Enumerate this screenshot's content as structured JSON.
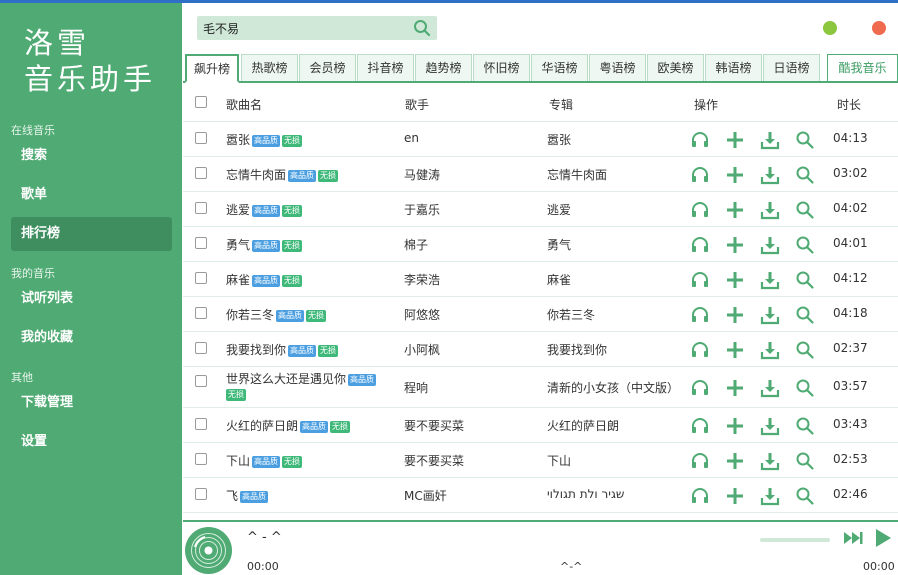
{
  "app": {
    "logo_line1": "洛雪",
    "logo_line2": "音乐助手"
  },
  "sidebar": {
    "sections": [
      {
        "title": "在线音乐",
        "items": [
          "搜索",
          "歌单",
          "排行榜"
        ]
      },
      {
        "title": "我的音乐",
        "items": [
          "试听列表",
          "我的收藏"
        ]
      },
      {
        "title": "其他",
        "items": [
          "下载管理",
          "设置"
        ]
      }
    ],
    "active": "排行榜"
  },
  "search": {
    "value": "毛不易"
  },
  "window_controls": {
    "min_color": "#8cc63f",
    "close_color": "#f06a4f"
  },
  "tabs": {
    "items": [
      "飙升榜",
      "热歌榜",
      "会员榜",
      "抖音榜",
      "趋势榜",
      "怀旧榜",
      "华语榜",
      "粤语榜",
      "欧美榜",
      "韩语榜",
      "日语榜"
    ],
    "active": "飙升榜",
    "source_label": "酷我音乐"
  },
  "table": {
    "headers": {
      "name": "歌曲名",
      "singer": "歌手",
      "album": "专辑",
      "actions": "操作",
      "duration": "时长"
    },
    "badges": {
      "hq": "高品质",
      "lossless": "无损"
    },
    "rows": [
      {
        "name": "嚣张",
        "singer": "en",
        "album": "嚣张",
        "duration": "04:13",
        "hq": true,
        "lossless": true
      },
      {
        "name": "忘情牛肉面",
        "singer": "马健涛",
        "album": "忘情牛肉面",
        "duration": "03:02",
        "hq": true,
        "lossless": true
      },
      {
        "name": "逃爱",
        "singer": "于嘉乐",
        "album": "逃爱",
        "duration": "04:02",
        "hq": true,
        "lossless": true
      },
      {
        "name": "勇气",
        "singer": "棉子",
        "album": "勇气",
        "duration": "04:01",
        "hq": true,
        "lossless": true
      },
      {
        "name": "麻雀",
        "singer": "李荣浩",
        "album": "麻雀",
        "duration": "04:12",
        "hq": true,
        "lossless": true
      },
      {
        "name": "你若三冬",
        "singer": "阿悠悠",
        "album": "你若三冬",
        "duration": "04:18",
        "hq": true,
        "lossless": true
      },
      {
        "name": "我要找到你",
        "singer": "小阿枫",
        "album": "我要找到你",
        "duration": "02:37",
        "hq": true,
        "lossless": true
      },
      {
        "name": "世界这么大还是遇见你",
        "singer": "程响",
        "album": "清新的小女孩（中文版）",
        "duration": "03:57",
        "hq": true,
        "lossless": true
      },
      {
        "name": "火红的萨日朗",
        "singer": "要不要买菜",
        "album": "火红的萨日朗",
        "duration": "03:43",
        "hq": true,
        "lossless": true
      },
      {
        "name": "下山",
        "singer": "要不要买菜",
        "album": "下山",
        "duration": "02:53",
        "hq": true,
        "lossless": true
      },
      {
        "name": "飞",
        "singer": "MC画奸",
        "album": "שגיר ולת תגולוי",
        "duration": "02:46",
        "hq": true,
        "lossless": false
      }
    ]
  },
  "player": {
    "title": "^ - ^",
    "center": "^-^",
    "current_time": "00:00",
    "total_time": "00:00"
  },
  "colors": {
    "accent": "#4faa73",
    "accent_dark": "#3e8e5f",
    "badge_hq": "#4b9fe0",
    "badge_lossless": "#3fb97a"
  },
  "icons": [
    "search-icon",
    "headphones-icon",
    "plus-icon",
    "download-icon",
    "magnifier-icon",
    "next-track-icon",
    "play-icon",
    "disc-icon"
  ]
}
